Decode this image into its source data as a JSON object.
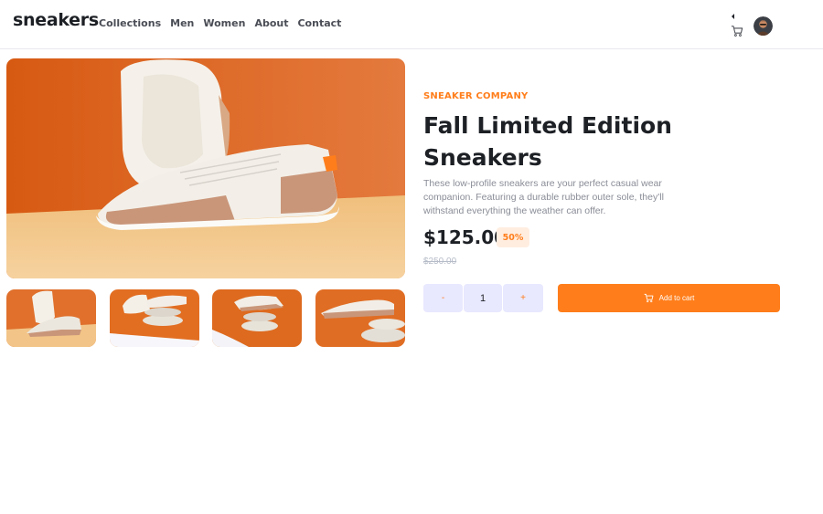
{
  "header": {
    "logo": "sneakers",
    "nav": [
      "Collections",
      "Men",
      "Women",
      "About",
      "Contact"
    ]
  },
  "icons": {
    "cart": "cart-icon",
    "avatar": "avatar"
  },
  "gallery": {
    "main_image": "sneaker product photo on orange background",
    "thumbnails": 4
  },
  "product": {
    "company": "SNEAKER COMPANY",
    "title": "Fall Limited Edition Sneakers",
    "description": "These low-profile sneakers are your perfect casual wear companion. Featuring a durable rubber outer sole, they'll withstand everything the weather can offer.",
    "price": "$125.00",
    "discount": "50%",
    "original_price": "$250.00"
  },
  "quantity": {
    "minus": "-",
    "value": "1",
    "plus": "+"
  },
  "add_to_cart": "Add to cart",
  "colors": {
    "accent": "#ff7e1b",
    "accent_light": "#ffede0",
    "qty_bg": "#e8e8ff",
    "dark": "#1d2025",
    "muted": "#8a8d97"
  }
}
